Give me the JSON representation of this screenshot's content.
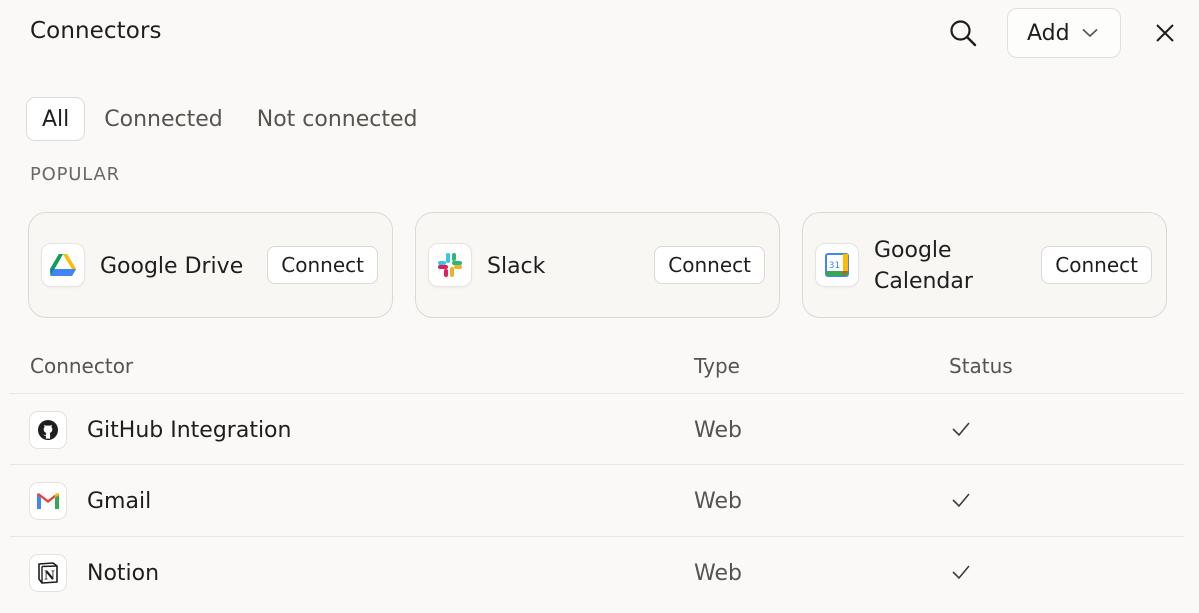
{
  "header": {
    "title": "Connectors",
    "add_label": "Add"
  },
  "tabs": [
    {
      "label": "All",
      "active": true
    },
    {
      "label": "Connected",
      "active": false
    },
    {
      "label": "Not connected",
      "active": false
    }
  ],
  "popular": {
    "label": "POPULAR",
    "cards": [
      {
        "name": "Google Drive",
        "icon": "google-drive-icon",
        "button": "Connect"
      },
      {
        "name": "Slack",
        "icon": "slack-icon",
        "button": "Connect"
      },
      {
        "name": "Google Calendar",
        "name_line1": "Google",
        "name_line2": "Calendar",
        "icon": "google-calendar-icon",
        "icon_text": "31",
        "button": "Connect"
      }
    ]
  },
  "table": {
    "headers": {
      "connector": "Connector",
      "type": "Type",
      "status": "Status"
    },
    "rows": [
      {
        "name": "GitHub Integration",
        "icon": "github-icon",
        "type": "Web",
        "status": "connected"
      },
      {
        "name": "Gmail",
        "icon": "gmail-icon",
        "type": "Web",
        "status": "connected"
      },
      {
        "name": "Notion",
        "icon": "notion-icon",
        "icon_text": "N",
        "type": "Web",
        "status": "connected"
      }
    ]
  },
  "colors": {
    "background": "#faf9f7",
    "text": "#1f1e1d",
    "muted": "#57534e",
    "border": "#dcd9d3"
  }
}
